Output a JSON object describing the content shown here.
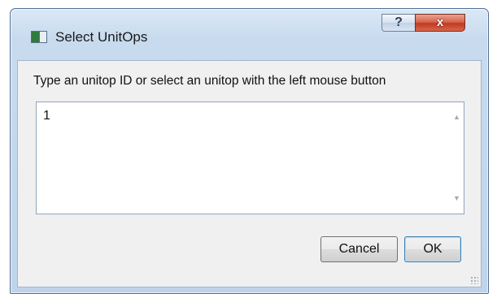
{
  "window": {
    "title": "Select UnitOps",
    "help_label": "?",
    "close_label": "x"
  },
  "dialog": {
    "prompt": "Type an unitop ID or select an unitop with the left mouse button",
    "input_value": "1",
    "scroll_up_icon": "▲",
    "scroll_down_icon": "▼"
  },
  "buttons": {
    "cancel_label": "Cancel",
    "ok_label": "OK"
  },
  "icons": {
    "app": "application-icon",
    "resize": "resize-grip-icon"
  }
}
